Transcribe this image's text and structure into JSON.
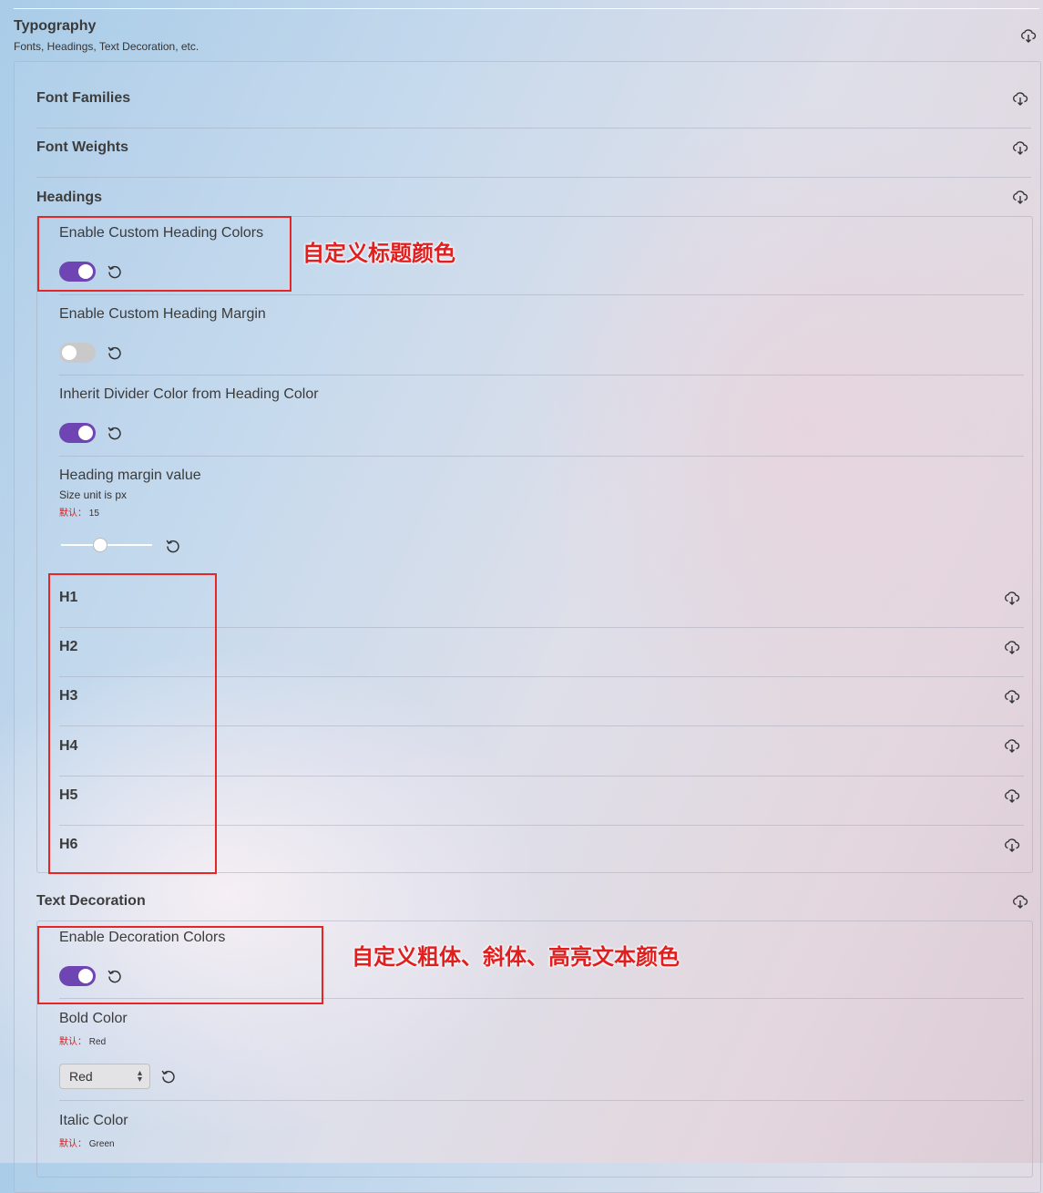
{
  "section": {
    "title": "Typography",
    "subtitle": "Fonts, Headings, Text Decoration, etc."
  },
  "groups": {
    "font_families": "Font Families",
    "font_weights": "Font Weights",
    "headings": "Headings",
    "text_decoration": "Text Decoration"
  },
  "headings_options": {
    "custom_colors": {
      "label": "Enable Custom Heading Colors",
      "enabled": true
    },
    "custom_margin": {
      "label": "Enable Custom Heading Margin",
      "enabled": false
    },
    "inherit_divider": {
      "label": "Inherit Divider Color from Heading Color",
      "enabled": true
    },
    "margin_value": {
      "label": "Heading margin value",
      "hint": "Size unit is px",
      "default_key": "默认：",
      "default_value": "15",
      "value": 15
    },
    "levels": [
      "H1",
      "H2",
      "H3",
      "H4",
      "H5",
      "H6"
    ]
  },
  "decoration_options": {
    "enable_colors": {
      "label": "Enable Decoration Colors",
      "enabled": true
    },
    "bold": {
      "label": "Bold Color",
      "default_key": "默认：",
      "default_value": "Red",
      "selected": "Red"
    },
    "italic": {
      "label": "Italic Color",
      "default_key": "默认：",
      "default_value": "Green"
    }
  },
  "annotations": {
    "heading_colors_note": "自定义标题颜色",
    "decoration_note": "自定义粗体、斜体、高亮文本颜色"
  },
  "colors": {
    "toggle_on": "#6f45b3",
    "toggle_off": "#c9c9c9",
    "annotation_red": "#e62525"
  }
}
